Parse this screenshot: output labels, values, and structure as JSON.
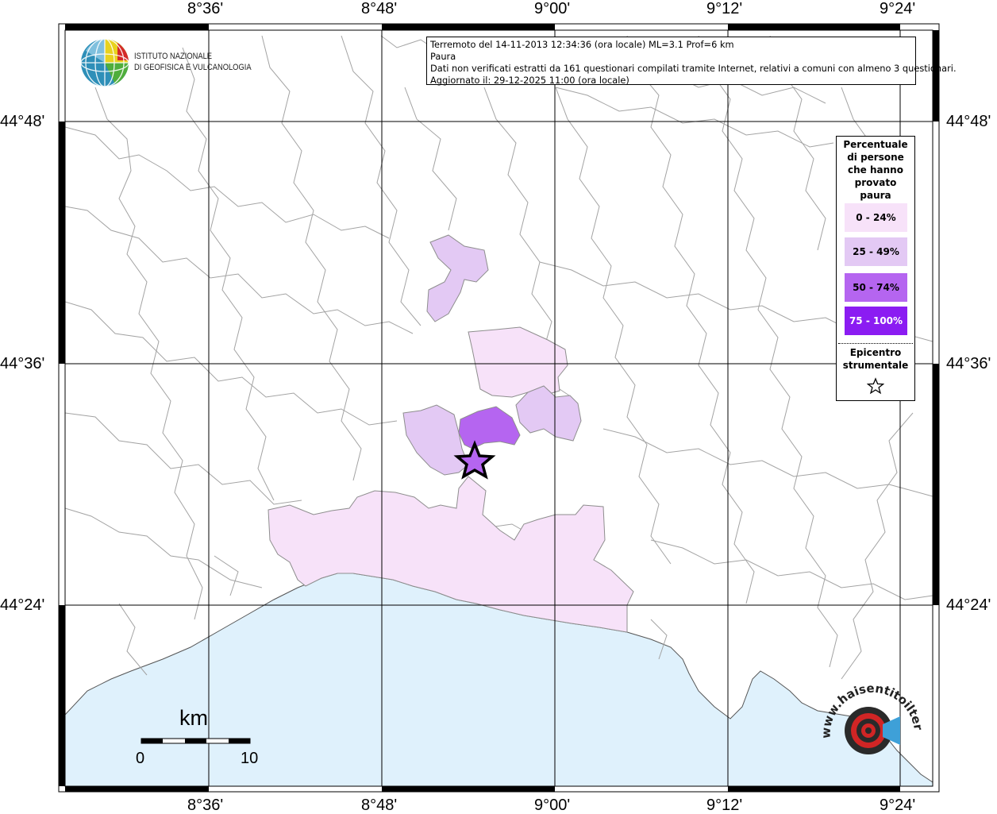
{
  "info": {
    "line1": "Terremoto del 14-11-2013 12:34:36 (ora locale) ML=3.1 Prof=6 km",
    "line2": "Paura",
    "line3": "Dati non verificati estratti da 161 questionari compilati tramite Internet, relativi a comuni con almeno 3 questionari.",
    "line4": "Aggiornato il: 29-12-2025 11:00 (ora locale)"
  },
  "axes": {
    "lon_labels": [
      "8°36'",
      "8°48'",
      "9°00'",
      "9°12'",
      "9°24'"
    ],
    "lat_labels": [
      "44°48'",
      "44°36'",
      "44°24'"
    ]
  },
  "logo_ingv": {
    "line1": "ISTITUTO NAZIONALE",
    "line2": "DI GEOFISICA E VULCANOLOGIA"
  },
  "legend": {
    "title": "Percentuale di persone che hanno provato paura",
    "items": [
      {
        "label": "0 - 24%",
        "color": "#f7e2f9"
      },
      {
        "label": "25 - 49%",
        "color": "#e3c9f4"
      },
      {
        "label": "50 - 74%",
        "color": "#b565f0"
      },
      {
        "label": "75 - 100%",
        "color": "#8b1cf2"
      }
    ],
    "epicenter_label": "Epicentro strumentale"
  },
  "scale": {
    "unit": "km",
    "min": "0",
    "max": "10"
  },
  "watermark": {
    "text": "www.haisentitoilterremoto.it"
  },
  "colors": {
    "sea": "#dff1fc",
    "land": "#ffffff",
    "boundary": "#9a9a9a",
    "grid": "#000000",
    "epicenter_fill": "#b565f0"
  }
}
